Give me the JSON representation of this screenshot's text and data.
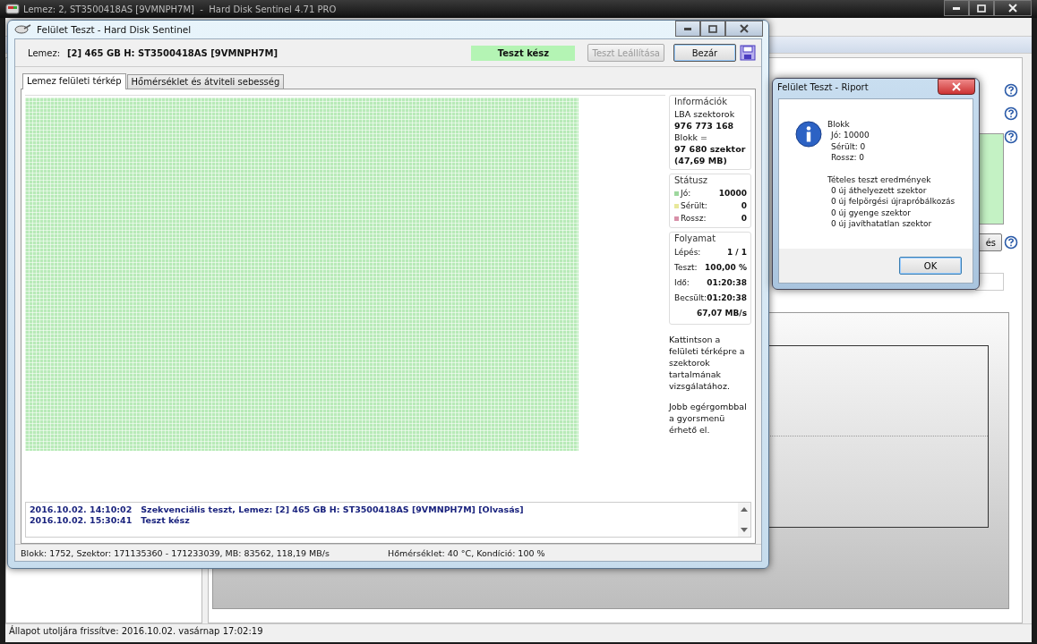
{
  "main_window": {
    "title": "Lemez: 2, ST3500418AS [9VMNPH7M]  -  Hard Disk Sentinel 4.71 PRO",
    "partial_button": "és",
    "status_bar": "Állapot utoljára frissítve: 2016.10.02. vasárnap 17:02:19"
  },
  "test_window": {
    "title": "Felület Teszt - Hard Disk Sentinel",
    "disk_label": "Lemez:",
    "disk_value": "[2] 465 GB H: ST3500418AS [9VMNPH7M]",
    "status_badge": "Teszt kész",
    "buttons": [
      {
        "label": "Teszt Leállítása",
        "disabled": true
      },
      {
        "label": "Bezár",
        "disabled": false
      }
    ],
    "tabs": [
      {
        "label": "Lemez felületi térkép",
        "selected": true
      },
      {
        "label": "Hőmérséklet és átviteli sebesség",
        "selected": false
      }
    ],
    "info": {
      "title": "Információk",
      "lines": [
        {
          "text": "LBA szektorok",
          "bold": false
        },
        {
          "text": "976 773 168",
          "bold": true
        },
        {
          "text": "Blokk =",
          "bold": false
        },
        {
          "text": "97 680 szektor",
          "bold": true
        },
        {
          "text": "(47,69 MB)",
          "bold": true
        }
      ]
    },
    "status": {
      "title": "Státusz",
      "rows": [
        {
          "label": "Jó:",
          "value": "10000",
          "color": "#9ed89e"
        },
        {
          "label": "Sérült:",
          "value": "0",
          "color": "#e8e89a"
        },
        {
          "label": "Rossz:",
          "value": "0",
          "color": "#d890a8"
        }
      ]
    },
    "progress": {
      "title": "Folyamat",
      "rows": [
        {
          "label": "Lépés:",
          "value": "1 / 1"
        },
        {
          "label": "Teszt:",
          "value": "100,00 %"
        },
        {
          "label": "Idő:",
          "value": "01:20:38"
        },
        {
          "label": "Becsült:",
          "value": "01:20:38"
        },
        {
          "label": "",
          "value": "67,07 MB/s"
        }
      ]
    },
    "hints": [
      "Kattintson a felületi térképre a szektorok tartalmának vizsgálatához.",
      "Jobb egérgombbal a gyorsmenü érhető el."
    ],
    "log": [
      {
        "time": "2016.10.02.  14:10:02",
        "message": "Szekvenciális teszt, Lemez: [2] 465 GB H: ST3500418AS [9VMNPH7M] [Olvasás]"
      },
      {
        "time": "2016.10.02.  15:30:41",
        "message": "Teszt kész"
      }
    ],
    "status_bar": {
      "left": "Blokk: 1752, Szektor: 171135360 - 171233039, MB: 83562, 118,19 MB/s",
      "right": "Hőmérséklet: 40  °C,  Kondíció: 100 %"
    }
  },
  "report_dialog": {
    "title": "Felület Teszt - Riport",
    "heading": "Blokk",
    "counts": [
      "Jó: 10000",
      "Sérült: 0",
      "Rossz: 0"
    ],
    "results_title": "Tételes teszt eredmények",
    "results": [
      "0 új áthelyezett szektor",
      "0 új felpörgési újrapróbálkozás",
      "0 új gyenge szektor",
      "0 új javíthatatlan szektor"
    ],
    "ok_button": "OK"
  }
}
